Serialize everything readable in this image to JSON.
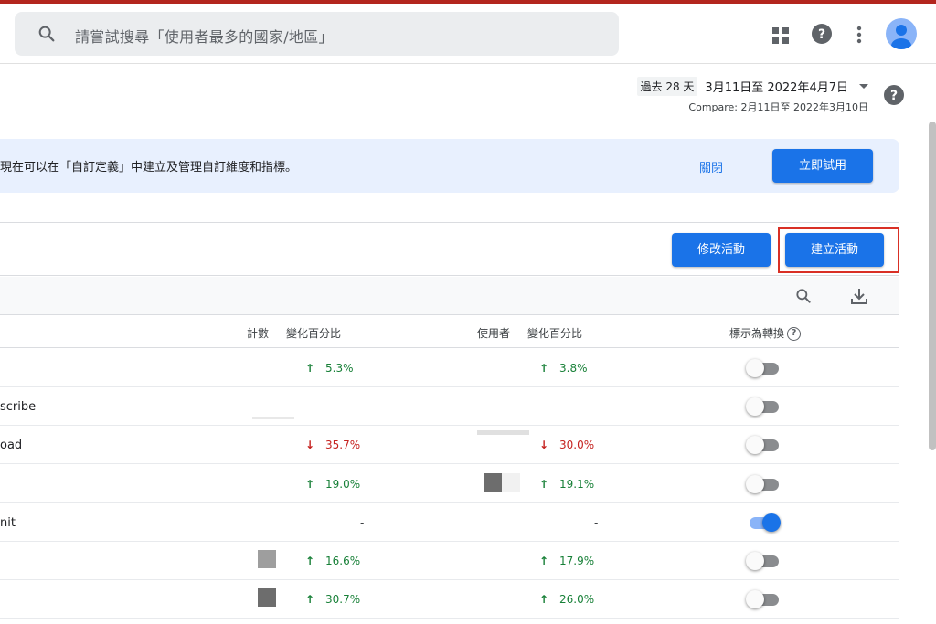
{
  "search": {
    "placeholder": "請嘗試搜尋「使用者最多的國家/地區」"
  },
  "topbar_icons": [
    "apps-grid-icon",
    "help-icon",
    "more-vert-icon",
    "account-avatar-icon"
  ],
  "date": {
    "period": "過去 28 天",
    "range": "3月11日至 2022年4月7日",
    "compare": "Compare: 2月11日至 2022年3月10日"
  },
  "banner": {
    "text": "現在可以在「自訂定義」中建立及管理自訂維度和指標。",
    "close_label": "關閉",
    "try_label": "立即試用"
  },
  "actions": {
    "modify_label": "修改活動",
    "create_label": "建立活動"
  },
  "columns": {
    "count": "計數",
    "count_change": "變化百分比",
    "users": "使用者",
    "users_change": "變化百分比",
    "conversion": "標示為轉換",
    "help": "?"
  },
  "rows": [
    {
      "name": "",
      "count_change": "5.3%",
      "count_dir": "up",
      "users_change": "3.8%",
      "users_dir": "up",
      "conversion": false
    },
    {
      "name": "scribe",
      "count_change": "-",
      "count_dir": "none",
      "users_change": "-",
      "users_dir": "none",
      "conversion": false
    },
    {
      "name": "oad",
      "count_change": "35.7%",
      "count_dir": "down",
      "users_change": "30.0%",
      "users_dir": "down",
      "conversion": false
    },
    {
      "name": "",
      "count_change": "19.0%",
      "count_dir": "up",
      "users_change": "19.1%",
      "users_dir": "up",
      "conversion": false
    },
    {
      "name": "nit",
      "count_change": "-",
      "count_dir": "none",
      "users_change": "-",
      "users_dir": "none",
      "conversion": true
    },
    {
      "name": "",
      "count_change": "16.6%",
      "count_dir": "up",
      "users_change": "17.9%",
      "users_dir": "up",
      "conversion": false
    },
    {
      "name": "",
      "count_change": "30.7%",
      "count_dir": "up",
      "users_change": "26.0%",
      "users_dir": "up",
      "conversion": false
    }
  ],
  "colors": {
    "primary": "#1a73e8",
    "up": "#188038",
    "down": "#c5221f",
    "highlight": "#d93025",
    "banner_bg": "#e8f0fe"
  }
}
